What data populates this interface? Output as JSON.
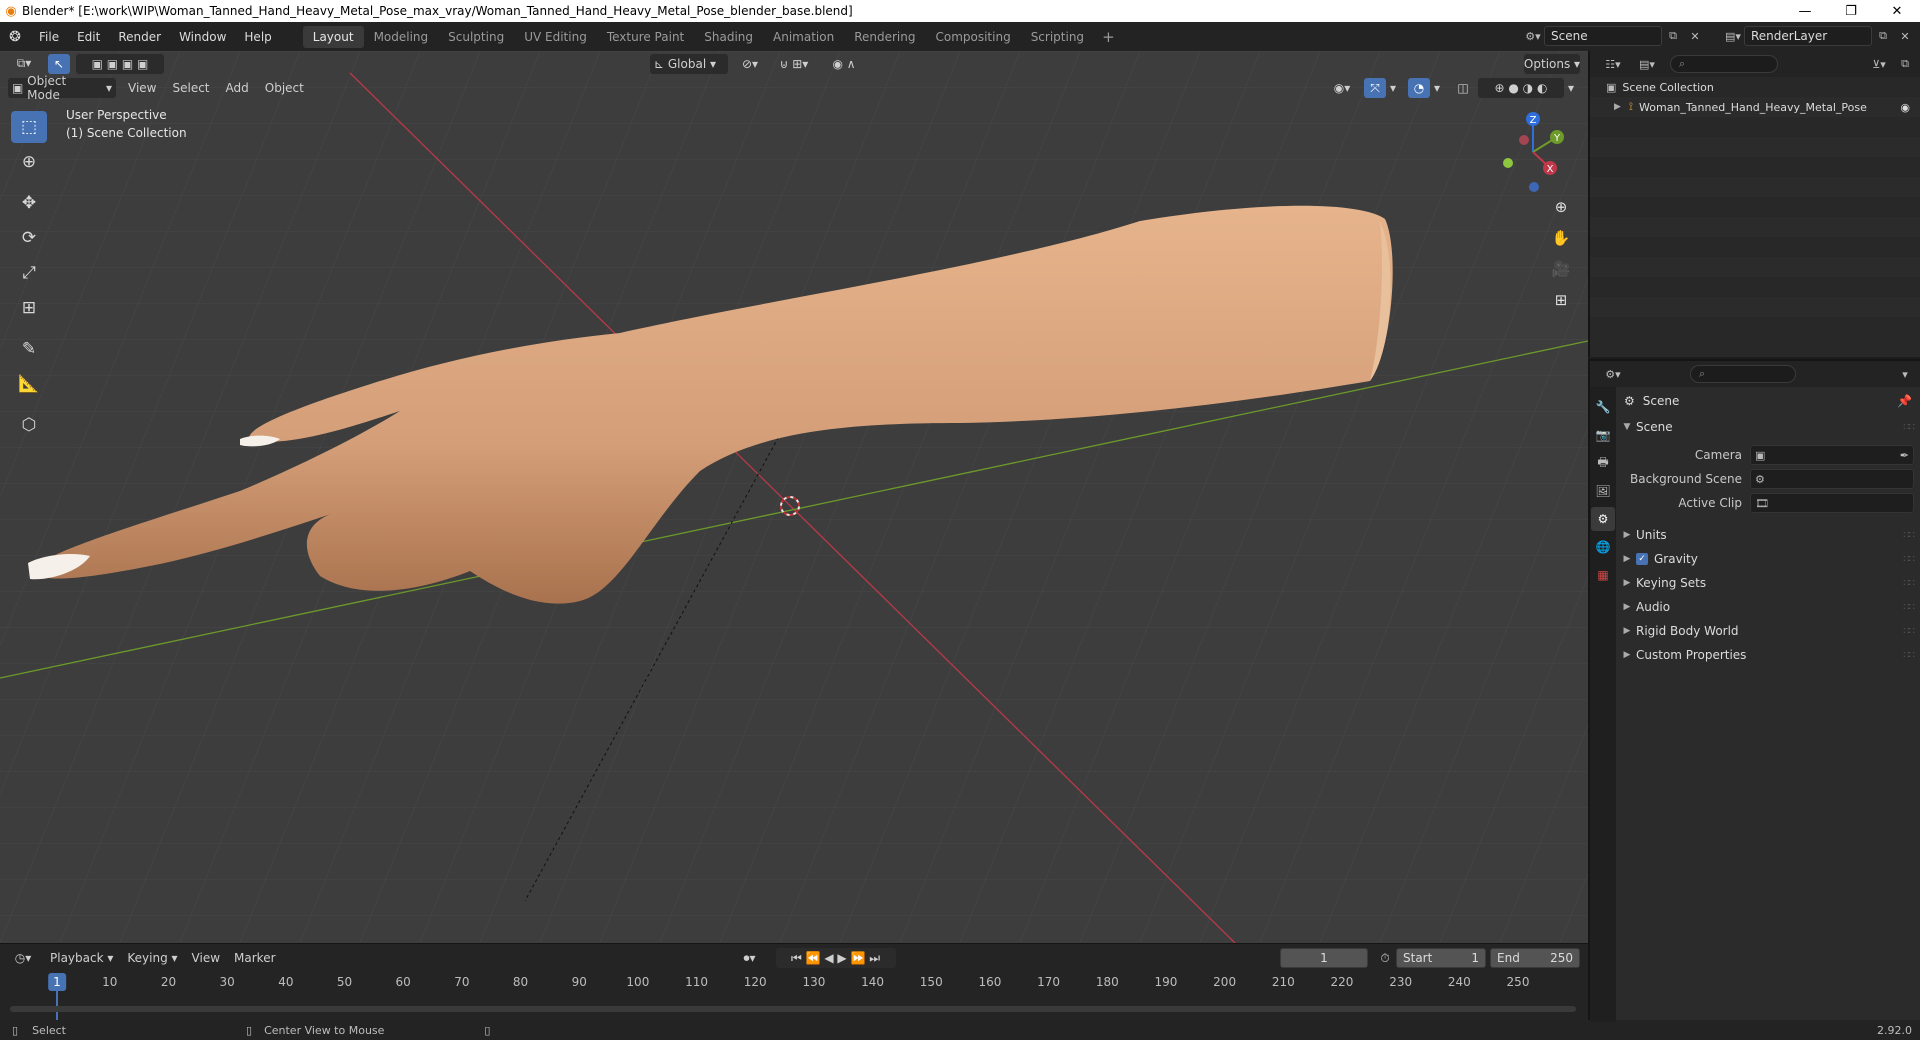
{
  "window": {
    "title": "Blender* [E:\\work\\WIP\\Woman_Tanned_Hand_Heavy_Metal_Pose_max_vray/Woman_Tanned_Hand_Heavy_Metal_Pose_blender_base.blend]",
    "minimize": "—",
    "restore": "❐",
    "close": "✕"
  },
  "menu": [
    "File",
    "Edit",
    "Render",
    "Window",
    "Help"
  ],
  "workspaces": [
    "Layout",
    "Modeling",
    "Sculpting",
    "UV Editing",
    "Texture Paint",
    "Shading",
    "Animation",
    "Rendering",
    "Compositing",
    "Scripting"
  ],
  "active_workspace": "Layout",
  "scene_field": "Scene",
  "renderlayer_field": "RenderLayer",
  "viewport": {
    "transform_orientation": "Global",
    "options_label": "Options",
    "mode": "Object Mode",
    "menus": [
      "View",
      "Select",
      "Add",
      "Object"
    ],
    "perspective_label": "User Perspective",
    "collection_label": "(1) Scene Collection",
    "gizmo": {
      "x": "X",
      "y": "Y",
      "z": "Z"
    }
  },
  "timeline": {
    "menus": [
      "Playback",
      "Keying",
      "View",
      "Marker"
    ],
    "current_frame": "1",
    "start_label": "Start",
    "start_value": "1",
    "end_label": "End",
    "end_value": "250",
    "ticks": [
      "1",
      "10",
      "20",
      "30",
      "40",
      "50",
      "60",
      "70",
      "80",
      "90",
      "100",
      "110",
      "120",
      "130",
      "140",
      "150",
      "160",
      "170",
      "180",
      "190",
      "200",
      "210",
      "220",
      "230",
      "240",
      "250"
    ]
  },
  "statusbar": {
    "select": "Select",
    "center_view": "Center View to Mouse",
    "version": "2.92.0"
  },
  "outliner": {
    "root": "Scene Collection",
    "object": "Woman_Tanned_Hand_Heavy_Metal_Pose"
  },
  "properties": {
    "context": "Scene",
    "section": "Scene",
    "camera_label": "Camera",
    "background_scene_label": "Background Scene",
    "active_clip_label": "Active Clip",
    "subsections": [
      "Units",
      "Gravity",
      "Keying Sets",
      "Audio",
      "Rigid Body World",
      "Custom Properties"
    ],
    "gravity_checked": true
  },
  "colors": {
    "accent": "#4772b3",
    "viewport_bg": "#3d3d3d",
    "x_axis": "#c0394a",
    "y_axis": "#6e9a2a",
    "z_axis": "#2f6fdb",
    "skin": "#d9a27a"
  }
}
